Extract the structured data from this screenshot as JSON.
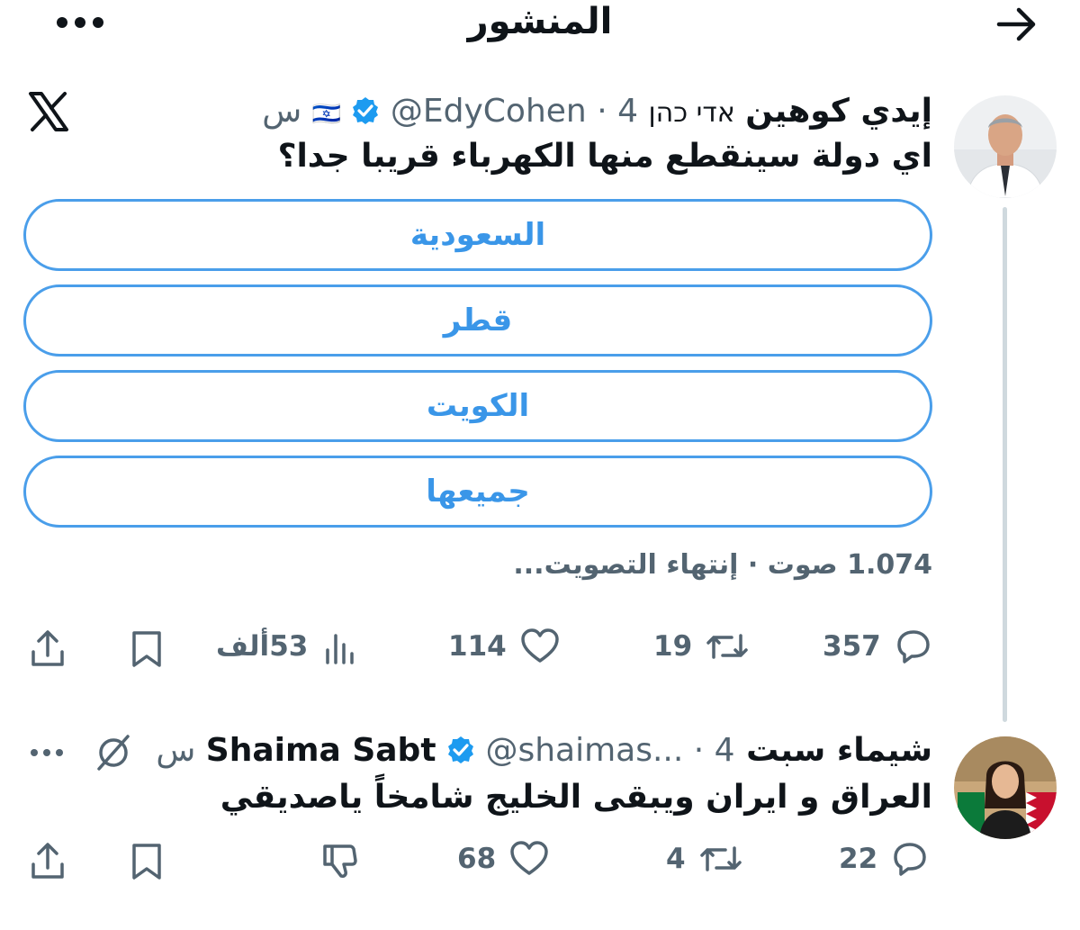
{
  "header": {
    "title": "المنشور",
    "back_icon": "arrow-right-icon",
    "more_icon": "more-dots-icon"
  },
  "main_post": {
    "display_name": "إيدي كوهين",
    "hebrew_name": "אדי כהן",
    "flag": "🇮🇱",
    "handle": "@EdyCohen",
    "time": "4 س",
    "separator": "·",
    "verified": true,
    "text": "اي دولة سينقطع منها الكهرباء قريبا جدا؟",
    "poll": {
      "options": [
        "السعودية",
        "قطر",
        "الكويت",
        "جميعها"
      ],
      "votes": "1.074 صوت",
      "status": "إنتهاء التصويت..."
    },
    "actions": {
      "replies": "357",
      "reposts": "19",
      "likes": "114",
      "views": "53ألف"
    }
  },
  "reply_post": {
    "display_name": "شيماء سبت Shaima Sabt",
    "handle": "@shaimas...",
    "time": "4 س",
    "separator": "·",
    "verified": true,
    "text": "العراق و ايران ويبقى الخليج شامخاً ياصديقي",
    "actions": {
      "replies": "22",
      "reposts": "4",
      "likes": "68"
    }
  },
  "colors": {
    "accent": "#1d9bf0",
    "poll_border": "#4a9eea",
    "muted": "#536471",
    "text": "#0f1419"
  }
}
